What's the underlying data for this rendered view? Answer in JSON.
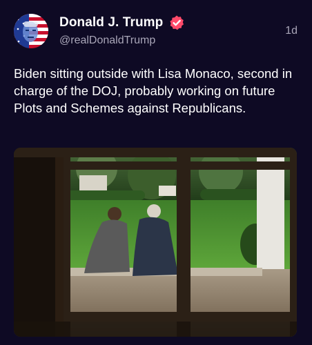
{
  "post": {
    "author": {
      "display_name": "Donald J. Trump",
      "handle": "@realDonaldTrump",
      "verified_icon": "verified-badge-icon",
      "badge_color": "#ff4a6a"
    },
    "timestamp": "1d",
    "text": "Biden sitting outside with Lisa Monaco, second in charge of the DOJ, probably working on future Plots and Schemes against Republicans.",
    "media": {
      "type": "photo"
    }
  },
  "colors": {
    "background": "#0e0a24",
    "text_primary": "#ffffff",
    "text_secondary": "#a9a6b8"
  }
}
